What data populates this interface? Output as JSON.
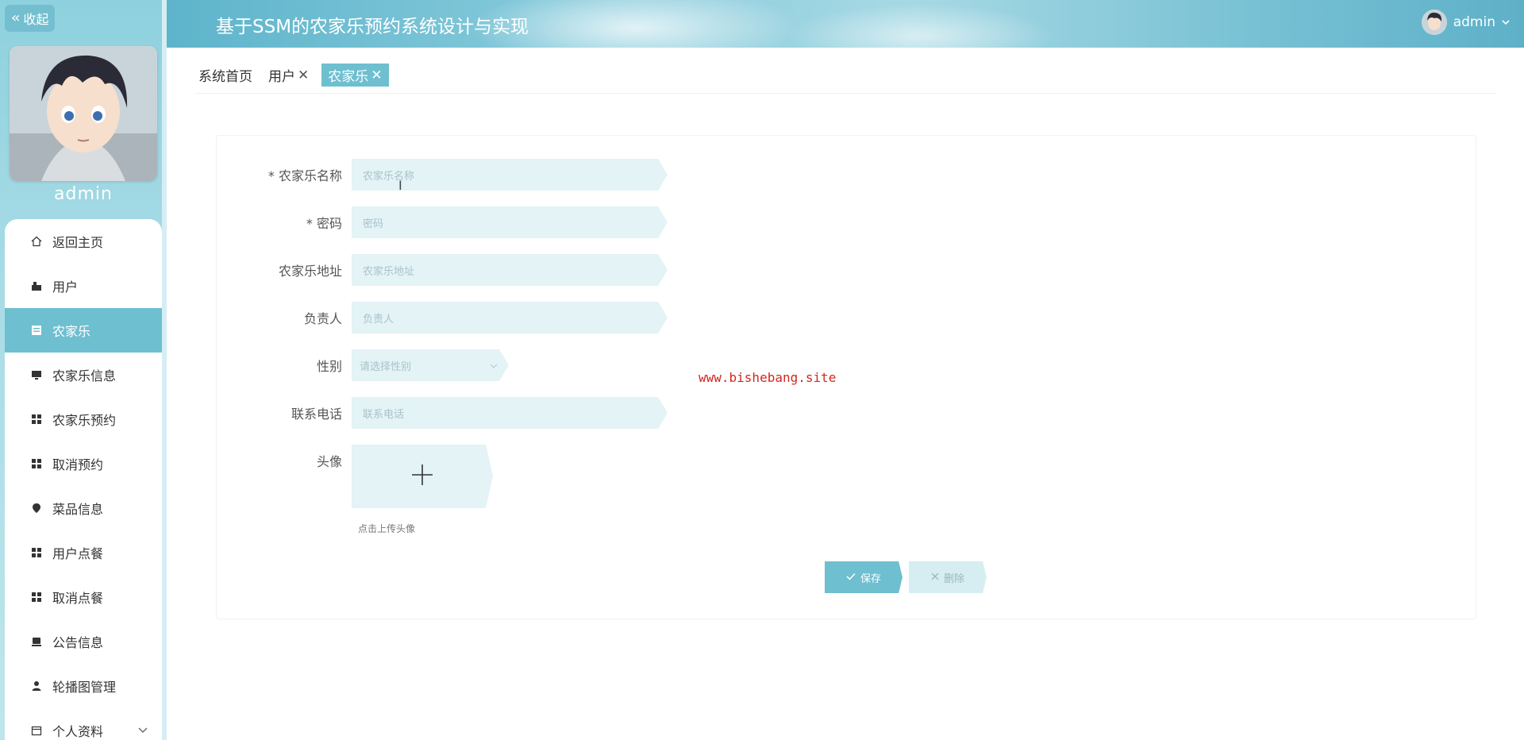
{
  "sidebar": {
    "collapse_label": "收起",
    "username": "admin",
    "menu": [
      {
        "label": "返回主页",
        "icon": "home-icon"
      },
      {
        "label": "用户",
        "icon": "user-group-icon"
      },
      {
        "label": "农家乐",
        "icon": "document-icon",
        "active": true
      },
      {
        "label": "农家乐信息",
        "icon": "monitor-icon"
      },
      {
        "label": "农家乐预约",
        "icon": "grid-icon"
      },
      {
        "label": "取消预约",
        "icon": "grid-icon"
      },
      {
        "label": "菜品信息",
        "icon": "location-icon"
      },
      {
        "label": "用户点餐",
        "icon": "grid-icon"
      },
      {
        "label": "取消点餐",
        "icon": "grid-icon"
      },
      {
        "label": "公告信息",
        "icon": "notice-icon"
      },
      {
        "label": "轮播图管理",
        "icon": "person-icon"
      },
      {
        "label": "个人资料",
        "icon": "calendar-icon",
        "expandable": true
      }
    ]
  },
  "header": {
    "title": "基于SSM的农家乐预约系统设计与实现",
    "username": "admin"
  },
  "tabs": [
    {
      "label": "系统首页",
      "closable": false
    },
    {
      "label": "用户",
      "closable": true
    },
    {
      "label": "农家乐",
      "closable": true,
      "active": true
    }
  ],
  "form": {
    "name_label": "* 农家乐名称",
    "name_placeholder": "农家乐名称",
    "password_label": "* 密码",
    "password_placeholder": "密码",
    "address_label": "农家乐地址",
    "address_placeholder": "农家乐地址",
    "manager_label": "负责人",
    "manager_placeholder": "负责人",
    "gender_label": "性别",
    "gender_placeholder": "请选择性别",
    "phone_label": "联系电话",
    "phone_placeholder": "联系电话",
    "avatar_label": "头像",
    "avatar_tip": "点击上传头像",
    "save_label": "保存",
    "delete_label": "删除"
  },
  "watermark": "www.bishebang.site",
  "colors": {
    "accent": "#6ebfd0",
    "input_bg": "#e3f3f6",
    "watermark": "#d0281f"
  }
}
